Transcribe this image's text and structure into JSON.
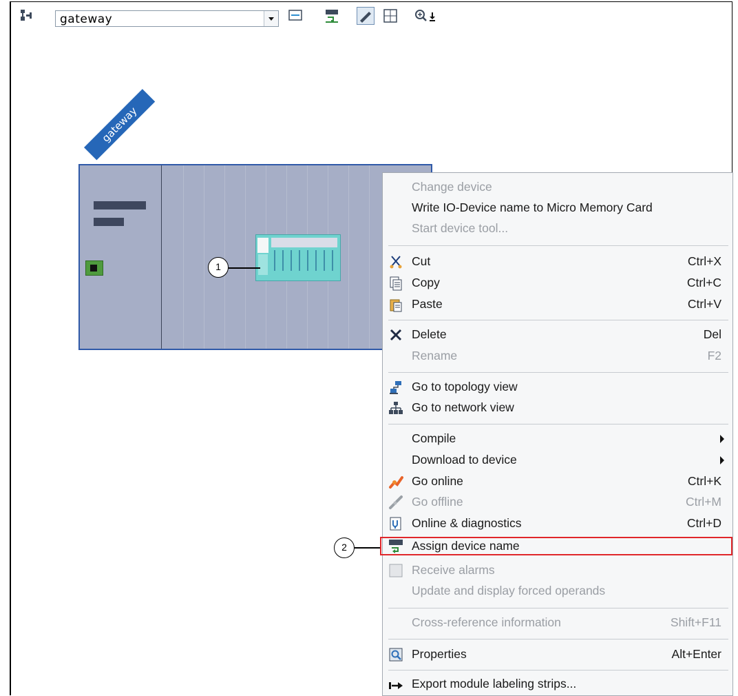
{
  "toolbar": {
    "device_select_value": "gateway",
    "icons": [
      "network-view-icon",
      "dropdown-arrow-icon",
      "fit-view-icon",
      "assign-name-icon",
      "pen-tool-icon",
      "grid-icon",
      "zoom-icon"
    ]
  },
  "canvas": {
    "device_tag": "gateway",
    "callout_1": "1",
    "callout_2": "2"
  },
  "context_menu": {
    "change_device": "Change device",
    "write_io_device": "Write IO-Device name to Micro Memory Card",
    "start_device_tool": "Start device tool...",
    "cut": "Cut",
    "cut_sc": "Ctrl+X",
    "copy": "Copy",
    "copy_sc": "Ctrl+C",
    "paste": "Paste",
    "paste_sc": "Ctrl+V",
    "delete": "Delete",
    "delete_sc": "Del",
    "rename": "Rename",
    "rename_sc": "F2",
    "go_topology": "Go to topology view",
    "go_network": "Go to network view",
    "compile": "Compile",
    "download": "Download to device",
    "go_online": "Go online",
    "go_online_sc": "Ctrl+K",
    "go_offline": "Go offline",
    "go_offline_sc": "Ctrl+M",
    "online_diag": "Online & diagnostics",
    "online_diag_sc": "Ctrl+D",
    "assign_name": "Assign device name",
    "receive_alarms": "Receive alarms",
    "update_forced": "Update and display forced operands",
    "cross_ref": "Cross-reference information",
    "cross_ref_sc": "Shift+F11",
    "properties": "Properties",
    "properties_sc": "Alt+Enter",
    "export_strips": "Export module labeling strips..."
  },
  "colors": {
    "highlight": "#e0262a",
    "device_tag": "#2667b8",
    "rack": "#a6aec6",
    "module": "#6fd3cf"
  }
}
